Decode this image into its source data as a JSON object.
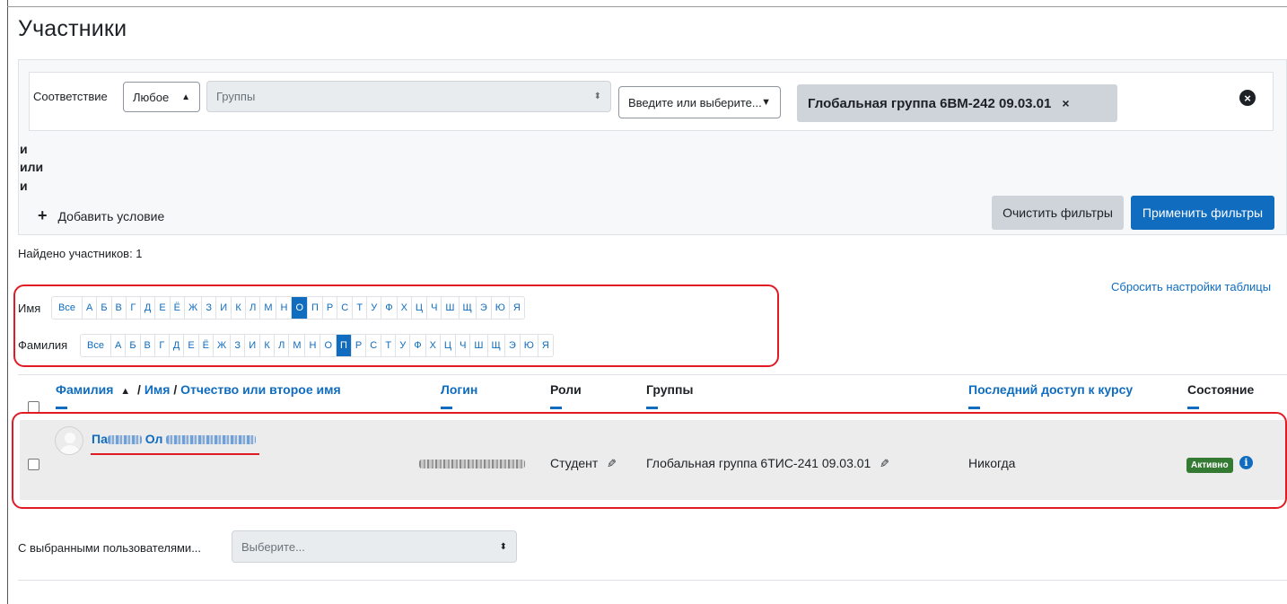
{
  "page": {
    "title": "Участники"
  },
  "filters": {
    "match_label": "Соответствие",
    "match_value": "Любое",
    "type_value": "Группы",
    "input_placeholder": "Введите или выберите...",
    "selected_tag": "Глобальная группа 6ВМ-242 09.03.01",
    "tag_remove": "×",
    "logic_words": [
      "и",
      "или",
      "и"
    ],
    "add_condition": "Добавить условие",
    "clear_button": "Очистить фильтры",
    "apply_button": "Применить фильтры"
  },
  "results": {
    "found_text": "Найдено участников: 1",
    "reset_link": "Сбросить настройки таблицы"
  },
  "initials": {
    "firstname_label": "Имя",
    "lastname_label": "Фамилия",
    "all_label": "Все",
    "letters": [
      "А",
      "Б",
      "В",
      "Г",
      "Д",
      "Е",
      "Ё",
      "Ж",
      "З",
      "И",
      "К",
      "Л",
      "М",
      "Н",
      "О",
      "П",
      "Р",
      "С",
      "Т",
      "У",
      "Ф",
      "Х",
      "Ц",
      "Ч",
      "Ш",
      "Щ",
      "Э",
      "Ю",
      "Я"
    ],
    "firstname_active": "О",
    "lastname_active": "П"
  },
  "table": {
    "col_lastname": "Фамилия",
    "col_firstname": "Имя",
    "col_middlename": "Отчество или второе имя",
    "col_login": "Логин",
    "col_roles": "Роли",
    "col_groups": "Группы",
    "col_lastaccess": "Последний доступ к курсу",
    "col_status": "Состояние",
    "sort_icon": "caret-up-icon",
    "rows": [
      {
        "name_prefix": "Па",
        "name_mid": "Ол",
        "role": "Студент",
        "group": "Глобальная группа 6ТИС-241 09.03.01",
        "last_access": "Никогда",
        "status": "Активно"
      }
    ]
  },
  "bulk": {
    "label": "С выбранными пользователями...",
    "select_value": "Выберите..."
  },
  "colors": {
    "primary": "#0f6cbf",
    "secondary_btn": "#ced4da",
    "highlight_red": "#e01b24",
    "active_badge": "#357a32"
  }
}
